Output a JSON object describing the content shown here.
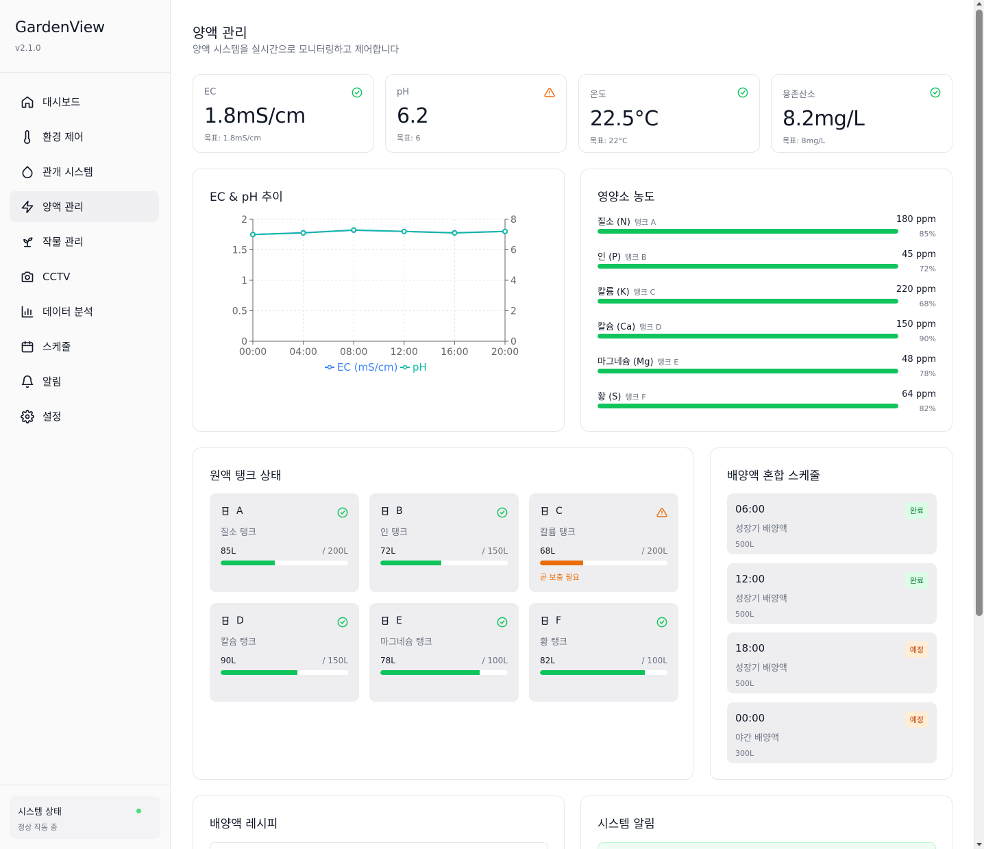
{
  "sidebar": {
    "title": "GardenView",
    "version": "v2.1.0",
    "items": [
      {
        "label": "대시보드",
        "icon": "home-icon"
      },
      {
        "label": "환경 제어",
        "icon": "thermometer-icon"
      },
      {
        "label": "관개 시스템",
        "icon": "droplet-icon"
      },
      {
        "label": "양액 관리",
        "icon": "zap-icon",
        "active": true
      },
      {
        "label": "작물 관리",
        "icon": "sprout-icon"
      },
      {
        "label": "CCTV",
        "icon": "camera-icon"
      },
      {
        "label": "데이터 분석",
        "icon": "bar-chart-icon"
      },
      {
        "label": "스케줄",
        "icon": "calendar-icon"
      },
      {
        "label": "알림",
        "icon": "bell-icon"
      },
      {
        "label": "설정",
        "icon": "gear-icon"
      }
    ],
    "status_title": "시스템 상태",
    "status_sub": "정상 작동 중",
    "status_color": "#4ade80"
  },
  "header": {
    "title": "양액 관리",
    "subtitle": "양액 시스템을 실시간으로 모니터링하고 제어합니다"
  },
  "metrics": [
    {
      "label": "EC",
      "value": "1.8mS/cm",
      "target": "목표: 1.8mS/cm",
      "status": "ok"
    },
    {
      "label": "pH",
      "value": "6.2",
      "target": "목표: 6",
      "status": "warn"
    },
    {
      "label": "온도",
      "value": "22.5°C",
      "target": "목표: 22°C",
      "status": "ok"
    },
    {
      "label": "용존산소",
      "value": "8.2mg/L",
      "target": "목표: 8mg/L",
      "status": "ok"
    }
  ],
  "chart_title": "EC & pH 추이",
  "chart_data": {
    "type": "line",
    "categories": [
      "00:00",
      "04:00",
      "08:00",
      "12:00",
      "16:00",
      "20:00"
    ],
    "series": [
      {
        "name": "EC (mS/cm)",
        "axis": "left",
        "color": "#3b82f6",
        "values": [
          1.75,
          1.78,
          1.82,
          1.8,
          1.78,
          1.8
        ]
      },
      {
        "name": "pH",
        "axis": "right",
        "color": "#14b8a6",
        "values": [
          7.0,
          7.1,
          7.3,
          7.2,
          7.1,
          7.2
        ]
      }
    ],
    "y_left": {
      "min": 0,
      "max": 2,
      "ticks": [
        "0",
        "0.5",
        "1",
        "1.5",
        "2"
      ],
      "tick_values": [
        0,
        0.5,
        1,
        1.5,
        2
      ]
    },
    "y_right": {
      "min": 0,
      "max": 8,
      "ticks": [
        "0",
        "2",
        "4",
        "6",
        "8"
      ],
      "tick_values": [
        0,
        2,
        4,
        6,
        8
      ]
    },
    "grid": true,
    "legend": "bottom"
  },
  "nutrients": {
    "title": "영양소 농도",
    "items": [
      {
        "name": "질소 (N)",
        "tank": "탱크 A",
        "ppm": "180 ppm",
        "pct_label": "85%",
        "pct": 85
      },
      {
        "name": "인 (P)",
        "tank": "탱크 B",
        "ppm": "45 ppm",
        "pct_label": "72%",
        "pct": 72
      },
      {
        "name": "칼륨 (K)",
        "tank": "탱크 C",
        "ppm": "220 ppm",
        "pct_label": "68%",
        "pct": 68
      },
      {
        "name": "칼슘 (Ca)",
        "tank": "탱크 D",
        "ppm": "150 ppm",
        "pct_label": "90%",
        "pct": 90
      },
      {
        "name": "마그네슘 (Mg)",
        "tank": "탱크 E",
        "ppm": "48 ppm",
        "pct_label": "78%",
        "pct": 78
      },
      {
        "name": "황 (S)",
        "tank": "탱크 F",
        "ppm": "64 ppm",
        "pct_label": "82%",
        "pct": 82
      }
    ]
  },
  "tanks": {
    "title": "원액 탱크 상태",
    "items": [
      {
        "id": "A",
        "name": "질소 탱크",
        "level": "85L",
        "cap": "/ 200L",
        "fill": 0.425,
        "status": "ok"
      },
      {
        "id": "B",
        "name": "인 탱크",
        "level": "72L",
        "cap": "/ 150L",
        "fill": 0.48,
        "status": "ok"
      },
      {
        "id": "C",
        "name": "칼륨 탱크",
        "level": "68L",
        "cap": "/ 200L",
        "fill": 0.34,
        "status": "warn",
        "warning": "곧 보충 필요"
      },
      {
        "id": "D",
        "name": "칼슘 탱크",
        "level": "90L",
        "cap": "/ 150L",
        "fill": 0.6,
        "status": "ok"
      },
      {
        "id": "E",
        "name": "마그네슘 탱크",
        "level": "78L",
        "cap": "/ 100L",
        "fill": 0.78,
        "status": "ok"
      },
      {
        "id": "F",
        "name": "황 탱크",
        "level": "82L",
        "cap": "/ 100L",
        "fill": 0.82,
        "status": "ok"
      }
    ]
  },
  "schedule": {
    "title": "배양액 혼합 스케줄",
    "items": [
      {
        "time": "06:00",
        "name": "성장기 배양액",
        "volume": "500L",
        "badge": "완료",
        "state": "done"
      },
      {
        "time": "12:00",
        "name": "성장기 배양액",
        "volume": "500L",
        "badge": "완료",
        "state": "done"
      },
      {
        "time": "18:00",
        "name": "성장기 배양액",
        "volume": "500L",
        "badge": "예정",
        "state": "plan"
      },
      {
        "time": "00:00",
        "name": "야간 배양액",
        "volume": "300L",
        "badge": "예정",
        "state": "plan"
      }
    ]
  },
  "recipe_title": "배양액 레시피",
  "alerts_title": "시스템 알림",
  "colors": {
    "ok": "#10c45c",
    "warn": "#ea6c0a",
    "accent": "#14b8a6"
  }
}
